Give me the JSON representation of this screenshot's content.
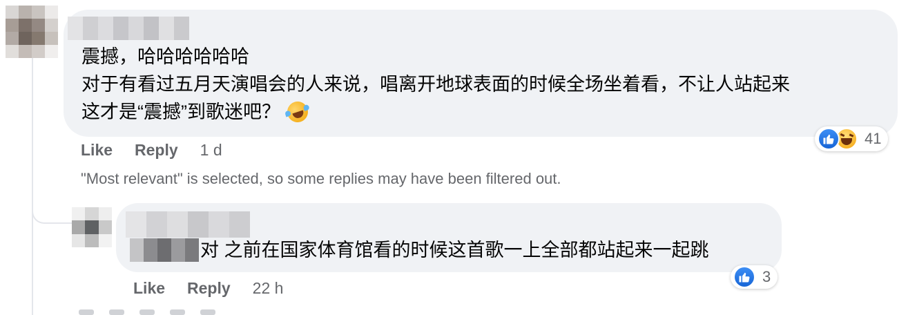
{
  "main_comment": {
    "lines": [
      "震撼，哈哈哈哈哈哈",
      "对于有看过五月天演唱会的人来说，唱离开地球表面的时候全场坐着看，不让人站起来",
      "这才是“震撼”到歌迷吧？"
    ],
    "emoji": "rolling-on-floor-laughing",
    "actions": {
      "like": "Like",
      "reply": "Reply",
      "time": "1 d"
    },
    "reactions": {
      "types": [
        "like",
        "haha"
      ],
      "count": "41"
    }
  },
  "filter_note": "\"Most relevant\" is selected, so some replies may have been filtered out.",
  "reply_comment": {
    "text": "对 之前在国家体育馆看的时候这首歌一上全部都站起来一起跳",
    "actions": {
      "like": "Like",
      "reply": "Reply",
      "time": "22 h"
    },
    "reactions": {
      "types": [
        "like"
      ],
      "count": "3"
    }
  },
  "colors": {
    "bubble": "#f0f2f5",
    "secondary_text": "#65676b",
    "like_blue": "#1877f2"
  }
}
